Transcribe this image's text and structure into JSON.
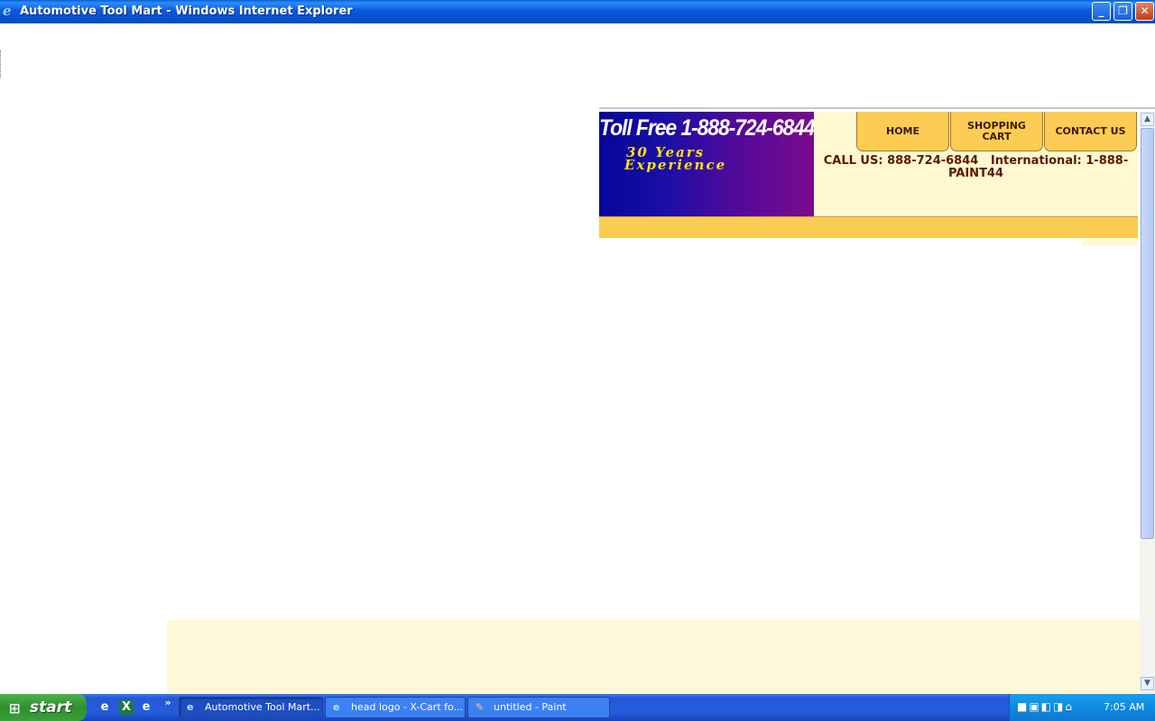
{
  "window": {
    "title": "Automotive Tool Mart - Windows Internet Explorer",
    "controls": {
      "minimize": "_",
      "restore": "❐",
      "close": "✕"
    }
  },
  "banner": {
    "toll_free": "Toll Free 1-888-724-6844",
    "experience_line1": "30 Years",
    "experience_line2": "Experience"
  },
  "nav": {
    "home": "HOME",
    "cart_line1": "SHOPPING",
    "cart_line2": "CART",
    "contact": "CONTACT US"
  },
  "callus": {
    "line1": "CALL US: 888-724-6844   International: 1-888-",
    "line2": "PAINT44"
  },
  "scrollbar": {
    "up": "▲",
    "down": "▼"
  },
  "taskbar": {
    "start": "start",
    "quicklaunch": [
      "ie-icon",
      "excel-icon",
      "ie-alt-icon"
    ],
    "overflow": "»",
    "tasks": [
      {
        "label": "Automotive Tool Mart...",
        "icon": "ie-icon",
        "active": true
      },
      {
        "label": "head logo - X-Cart fo...",
        "icon": "ie-icon",
        "active": false
      },
      {
        "label": "untitled - Paint",
        "icon": "paint-icon",
        "active": false
      }
    ],
    "clock": "7:05 AM"
  }
}
